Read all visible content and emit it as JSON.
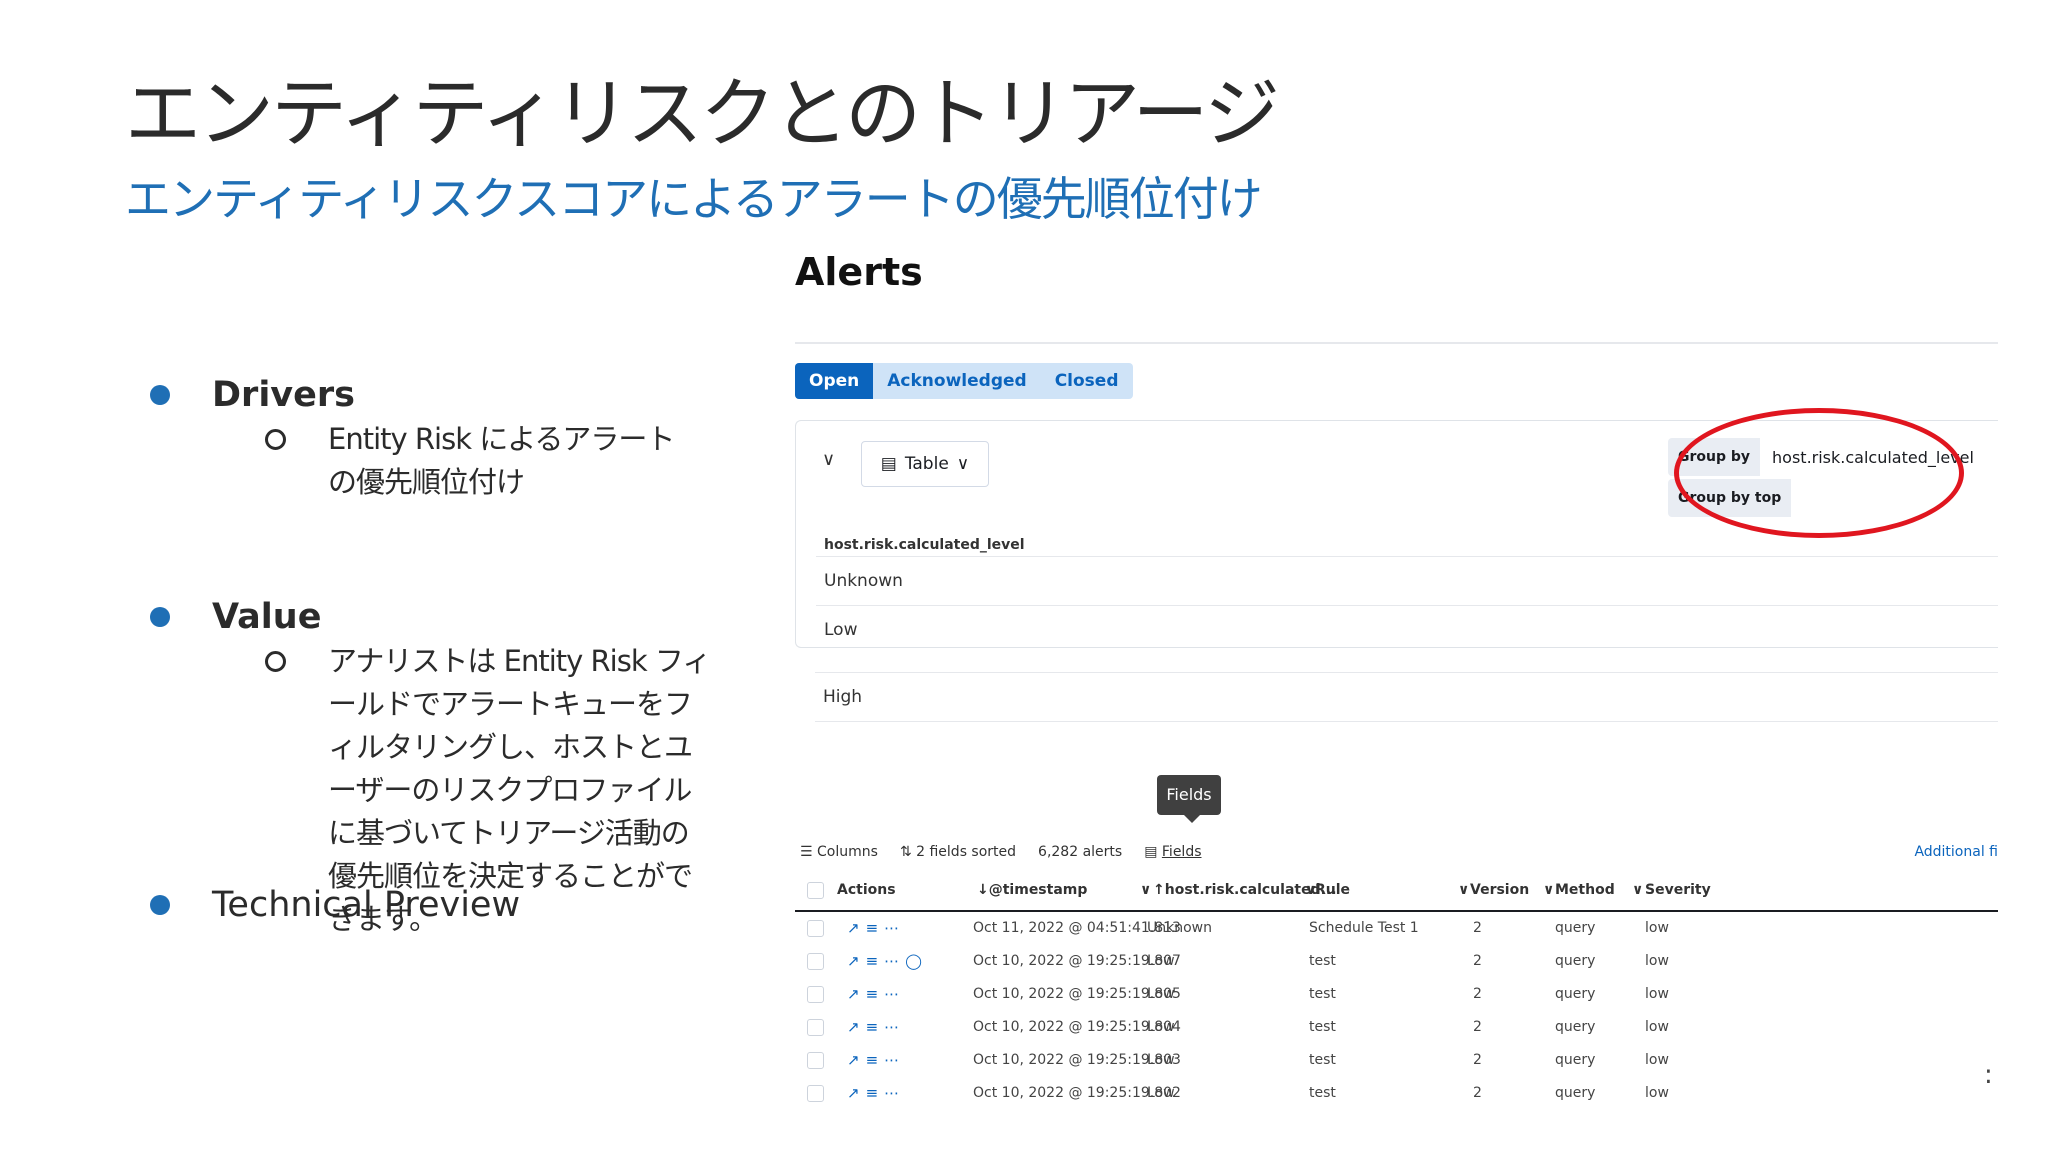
{
  "slide": {
    "title": "エンティティリスクとのトリアージ",
    "subtitle": "エンティティリスクスコアによるアラートの優先順位付け",
    "bullets": [
      {
        "label": "Drivers",
        "sub": "Entity Risk によるアラートの優先順位付け"
      },
      {
        "label": "Value",
        "sub": "アナリストは Entity Risk フィールドでアラートキューをフィルタリングし、ホストとユーザーのリスクプロファイルに基づいてトリアージ活動の優先順位を決定することができます。"
      },
      {
        "label": "Technical Preview"
      }
    ]
  },
  "app": {
    "heading": "Alerts",
    "tabs": [
      "Open",
      "Acknowledged",
      "Closed"
    ],
    "view_button": "Table",
    "group_by_label": "Group by",
    "group_by_value": "host.risk.calculated_level",
    "group_by_top_label": "Group by top",
    "group_field": "host.risk.calculated_level",
    "groups": [
      "Unknown",
      "Low",
      "High"
    ],
    "tooltip": "Fields",
    "toolbar": {
      "columns": "Columns",
      "sorted": "2 fields sorted",
      "count": "6,282 alerts",
      "fields": "Fields",
      "additional": "Additional fi"
    },
    "columns": [
      "Actions",
      "@timestamp",
      "host.risk.calculated...",
      "Rule",
      "Version",
      "Method",
      "Severity"
    ],
    "rows": [
      {
        "timestamp": "Oct 11, 2022 @ 04:51:41.813",
        "level": "Unknown",
        "rule": "Schedule Test 1",
        "version": "2",
        "method": "query",
        "severity": "low"
      },
      {
        "timestamp": "Oct 10, 2022 @ 19:25:19.807",
        "level": "Low",
        "rule": "test",
        "version": "2",
        "method": "query",
        "severity": "low"
      },
      {
        "timestamp": "Oct 10, 2022 @ 19:25:19.805",
        "level": "Low",
        "rule": "test",
        "version": "2",
        "method": "query",
        "severity": "low"
      },
      {
        "timestamp": "Oct 10, 2022 @ 19:25:19.804",
        "level": "Low",
        "rule": "test",
        "version": "2",
        "method": "query",
        "severity": "low"
      },
      {
        "timestamp": "Oct 10, 2022 @ 19:25:19.803",
        "level": "Low",
        "rule": "test",
        "version": "2",
        "method": "query",
        "severity": "low"
      },
      {
        "timestamp": "Oct 10, 2022 @ 19:25:19.802",
        "level": "Low",
        "rule": "test",
        "version": "2",
        "method": "query",
        "severity": "low"
      }
    ]
  },
  "colors": {
    "accent": "#1f6fb5",
    "highlight": "#e0161f",
    "primary": "#0b64bd"
  }
}
